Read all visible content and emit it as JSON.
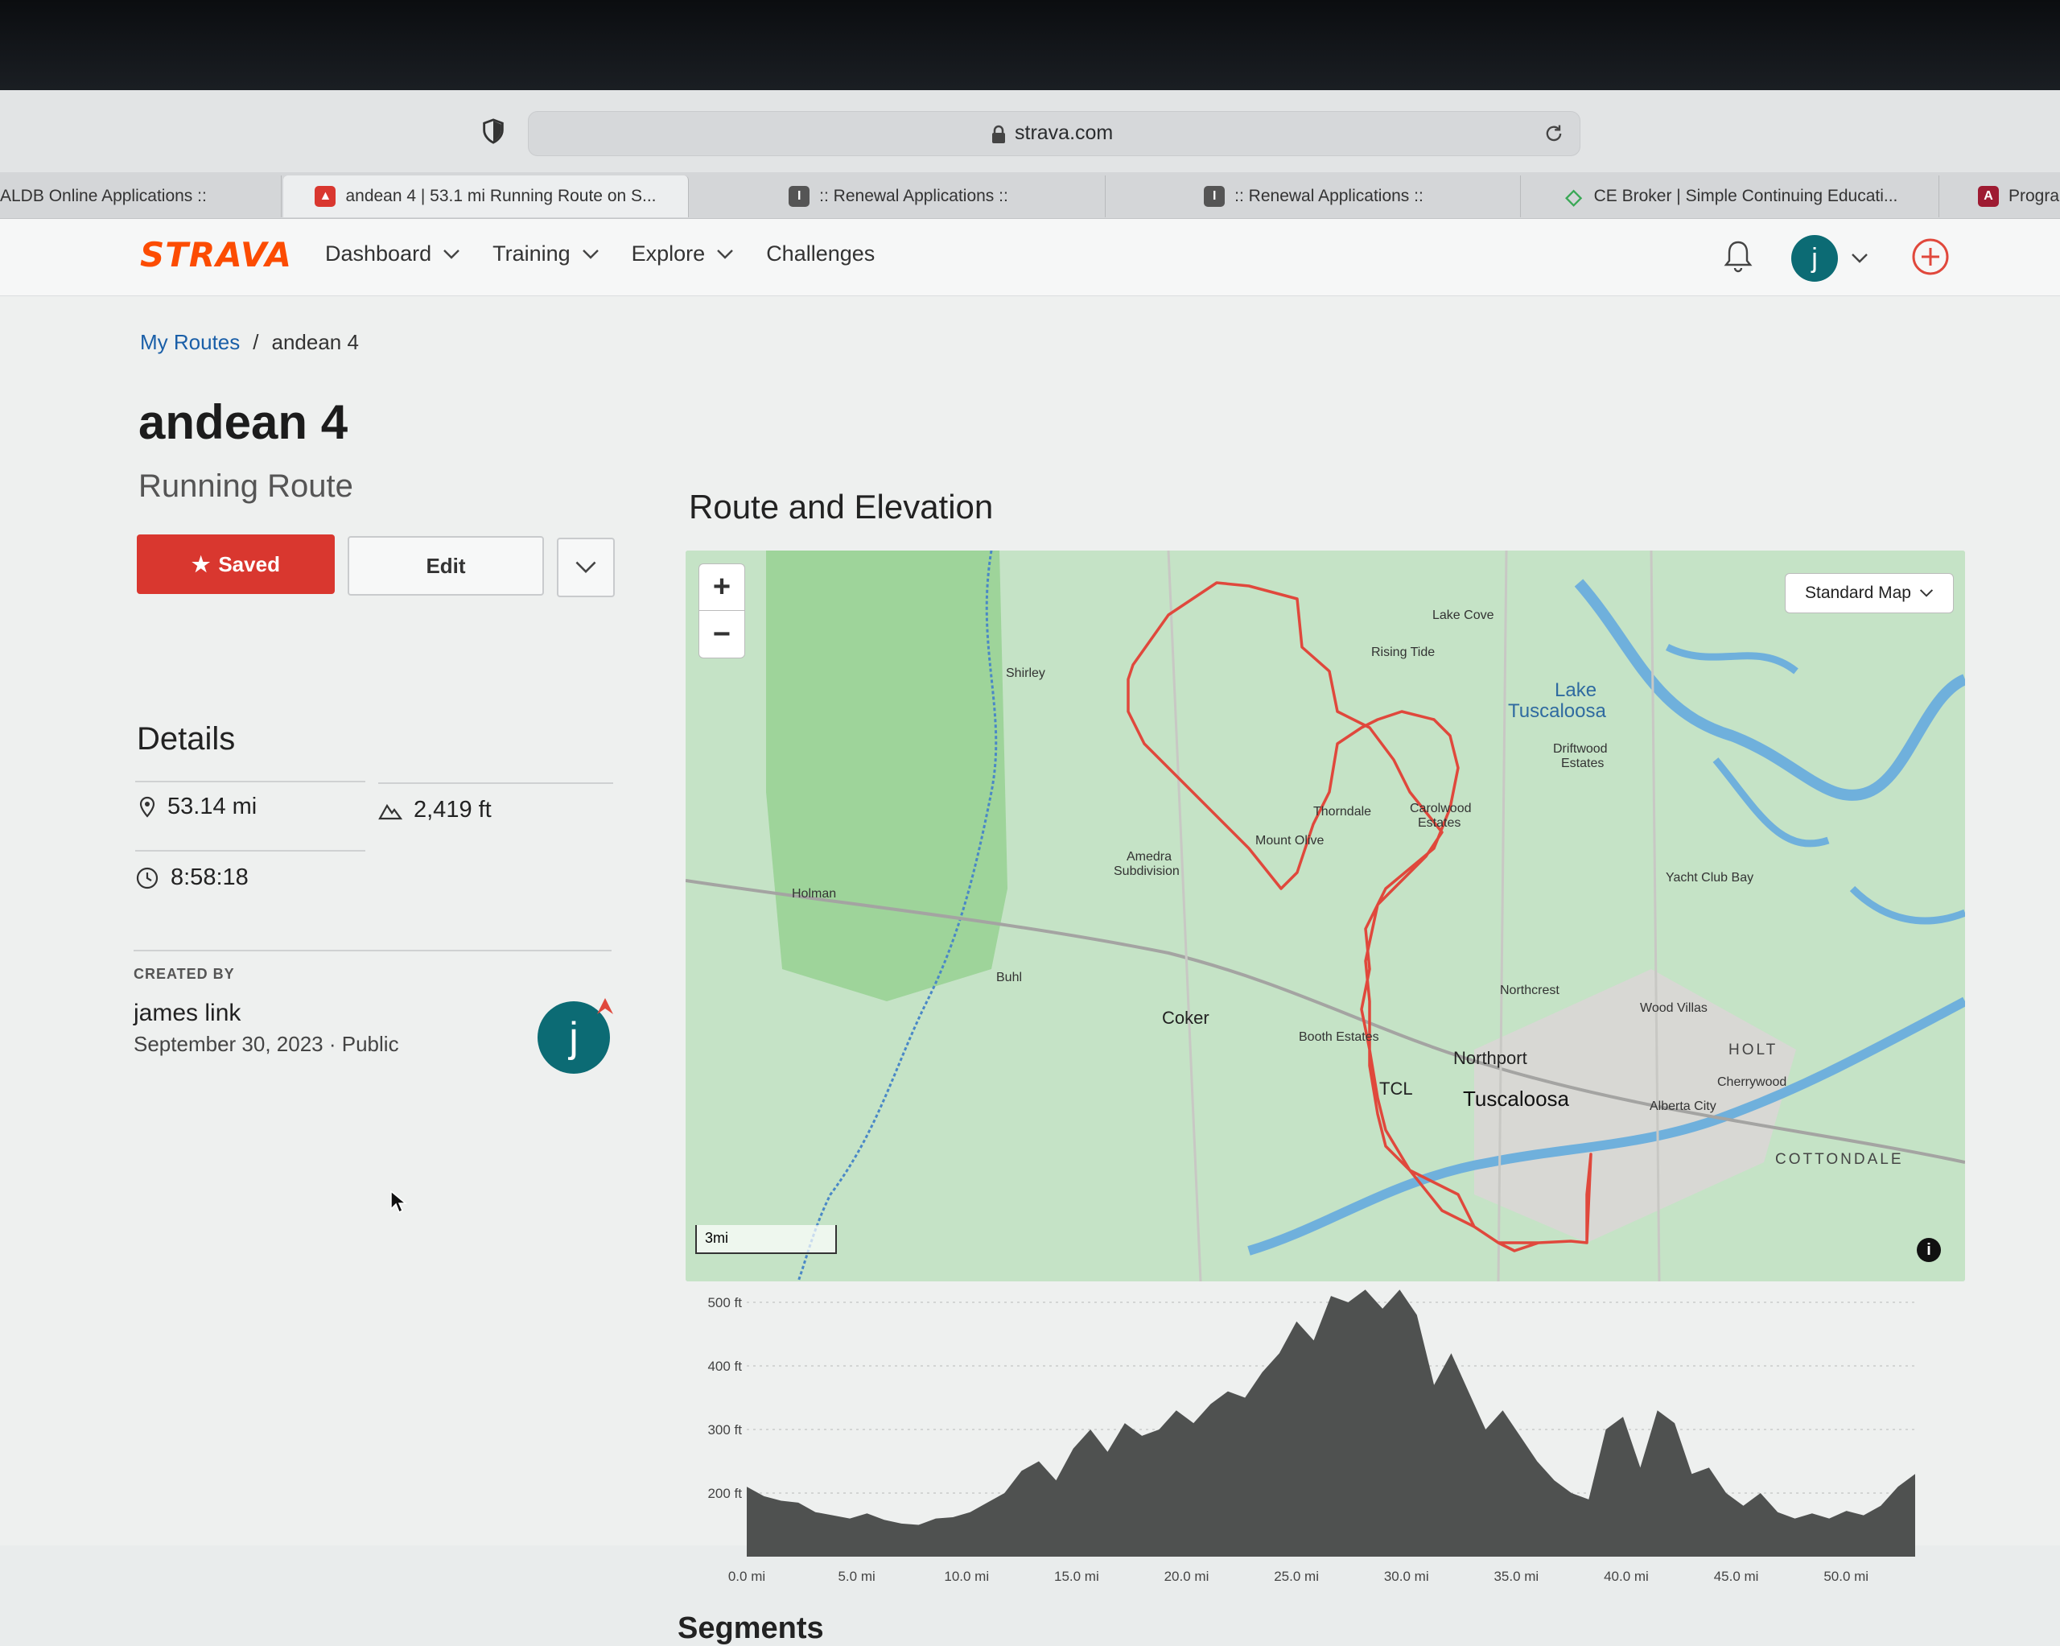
{
  "browser": {
    "url": "strava.com",
    "tabs": [
      {
        "title": "ALDB Online Applications ::",
        "active": false
      },
      {
        "title": "andean 4 | 53.1 mi Running Route on S...",
        "active": true
      },
      {
        "title": ":: Renewal Applications ::",
        "active": false
      },
      {
        "title": ":: Renewal Applications ::",
        "active": false
      },
      {
        "title": "CE Broker | Simple Continuing Educati...",
        "active": false
      },
      {
        "title": "Program",
        "active": false
      }
    ]
  },
  "header": {
    "logo": "STRAVA",
    "nav": [
      "Dashboard",
      "Training",
      "Explore",
      "Challenges"
    ],
    "avatar_letter": "j"
  },
  "breadcrumb": {
    "parent": "My Routes",
    "separator": "/",
    "current": "andean 4"
  },
  "route": {
    "title": "andean 4",
    "subtitle": "Running Route",
    "saved_label": "Saved",
    "edit_label": "Edit"
  },
  "details": {
    "heading": "Details",
    "distance": "53.14 mi",
    "elevation": "2,419 ft",
    "time": "8:58:18"
  },
  "creator": {
    "label": "CREATED BY",
    "name": "james link",
    "date": "September 30, 2023",
    "visibility": "Public",
    "avatar_letter": "j"
  },
  "map": {
    "heading": "Route and Elevation",
    "style_label": "Standard Map",
    "scale_label": "3mi",
    "labels": {
      "shirley": "Shirley",
      "lake_cove": "Lake Cove",
      "rising_tide": "Rising Tide",
      "lake": "Lake",
      "tuscaloosa_lake": "Tuscaloosa",
      "driftwood": "Driftwood",
      "estates": "Estates",
      "thorndale": "Thorndale",
      "carolwood": "Carolwood",
      "carolwood_estates": "Estates",
      "mount_olive": "Mount Olive",
      "amedra": "Amedra",
      "subdivision": "Subdivision",
      "holman": "Holman",
      "yacht_club": "Yacht Club Bay",
      "buhl": "Buhl",
      "coker": "Coker",
      "northcrest": "Northcrest",
      "wood_villas": "Wood Villas",
      "booth_estates": "Booth Estates",
      "northport": "Northport",
      "holt": "HOLT",
      "tcl": "TCL",
      "cherrywood": "Cherrywood",
      "tuscaloosa": "Tuscaloosa",
      "alberta": "Alberta City",
      "cottondale": "COTTONDALE"
    }
  },
  "elevation": {
    "y_ticks": [
      "500 ft",
      "400 ft",
      "300 ft",
      "200 ft"
    ],
    "x_ticks": [
      "0.0 mi",
      "5.0 mi",
      "10.0 mi",
      "15.0 mi",
      "20.0 mi",
      "25.0 mi",
      "30.0 mi",
      "35.0 mi",
      "40.0 mi",
      "45.0 mi",
      "50.0 mi"
    ],
    "profile_ft": [
      210,
      195,
      188,
      185,
      170,
      165,
      160,
      168,
      158,
      152,
      150,
      160,
      162,
      170,
      185,
      200,
      235,
      250,
      220,
      270,
      300,
      265,
      310,
      290,
      300,
      330,
      310,
      340,
      360,
      350,
      390,
      420,
      470,
      440,
      510,
      500,
      520,
      490,
      520,
      480,
      370,
      420,
      360,
      300,
      330,
      290,
      250,
      220,
      200,
      190,
      300,
      320,
      240,
      330,
      310,
      230,
      240,
      200,
      180,
      200,
      170,
      160,
      168,
      160,
      172,
      165,
      180,
      210,
      230
    ]
  },
  "segments": {
    "heading": "Segments"
  }
}
